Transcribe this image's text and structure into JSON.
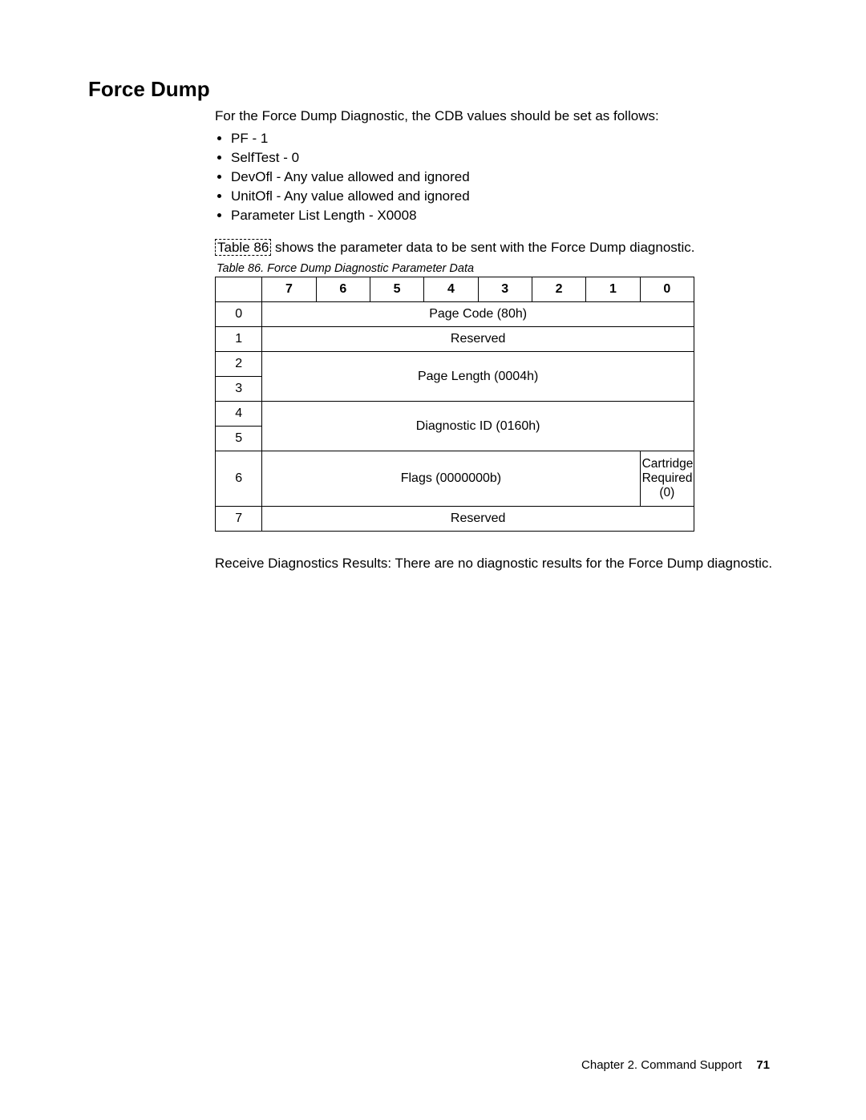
{
  "heading": "Force Dump",
  "intro": "For the Force Dump Diagnostic, the CDB values should be set as follows:",
  "bullets": [
    "PF - 1",
    "SelfTest - 0",
    "DevOfl - Any value allowed and ignored",
    "UnitOfl - Any value allowed and ignored",
    "Parameter List Length - X0008"
  ],
  "link_text": "Table 86",
  "mid_after_link": " shows the parameter data to be sent with the Force Dump diagnostic.",
  "table_caption": "Table 86. Force Dump Diagnostic Parameter Data",
  "bit_headers": [
    "7",
    "6",
    "5",
    "4",
    "3",
    "2",
    "1",
    "0"
  ],
  "rows": {
    "r0": {
      "byte": "0",
      "text": "Page Code (80h)"
    },
    "r1": {
      "byte": "1",
      "text": "Reserved"
    },
    "r2": {
      "byte": "2"
    },
    "r3": {
      "byte": "3"
    },
    "r23_text": "Page Length (0004h)",
    "r4": {
      "byte": "4"
    },
    "r5": {
      "byte": "5"
    },
    "r45_text": "Diagnostic ID (0160h)",
    "r6": {
      "byte": "6",
      "flags": "Flags (0000000b)",
      "cart": "Cartridge Required (0)"
    },
    "r7": {
      "byte": "7",
      "text": "Reserved"
    }
  },
  "afternote": "Receive Diagnostics Results: There are no diagnostic results for the Force Dump diagnostic.",
  "footer_chapter": "Chapter 2. Command Support",
  "footer_page": "71"
}
